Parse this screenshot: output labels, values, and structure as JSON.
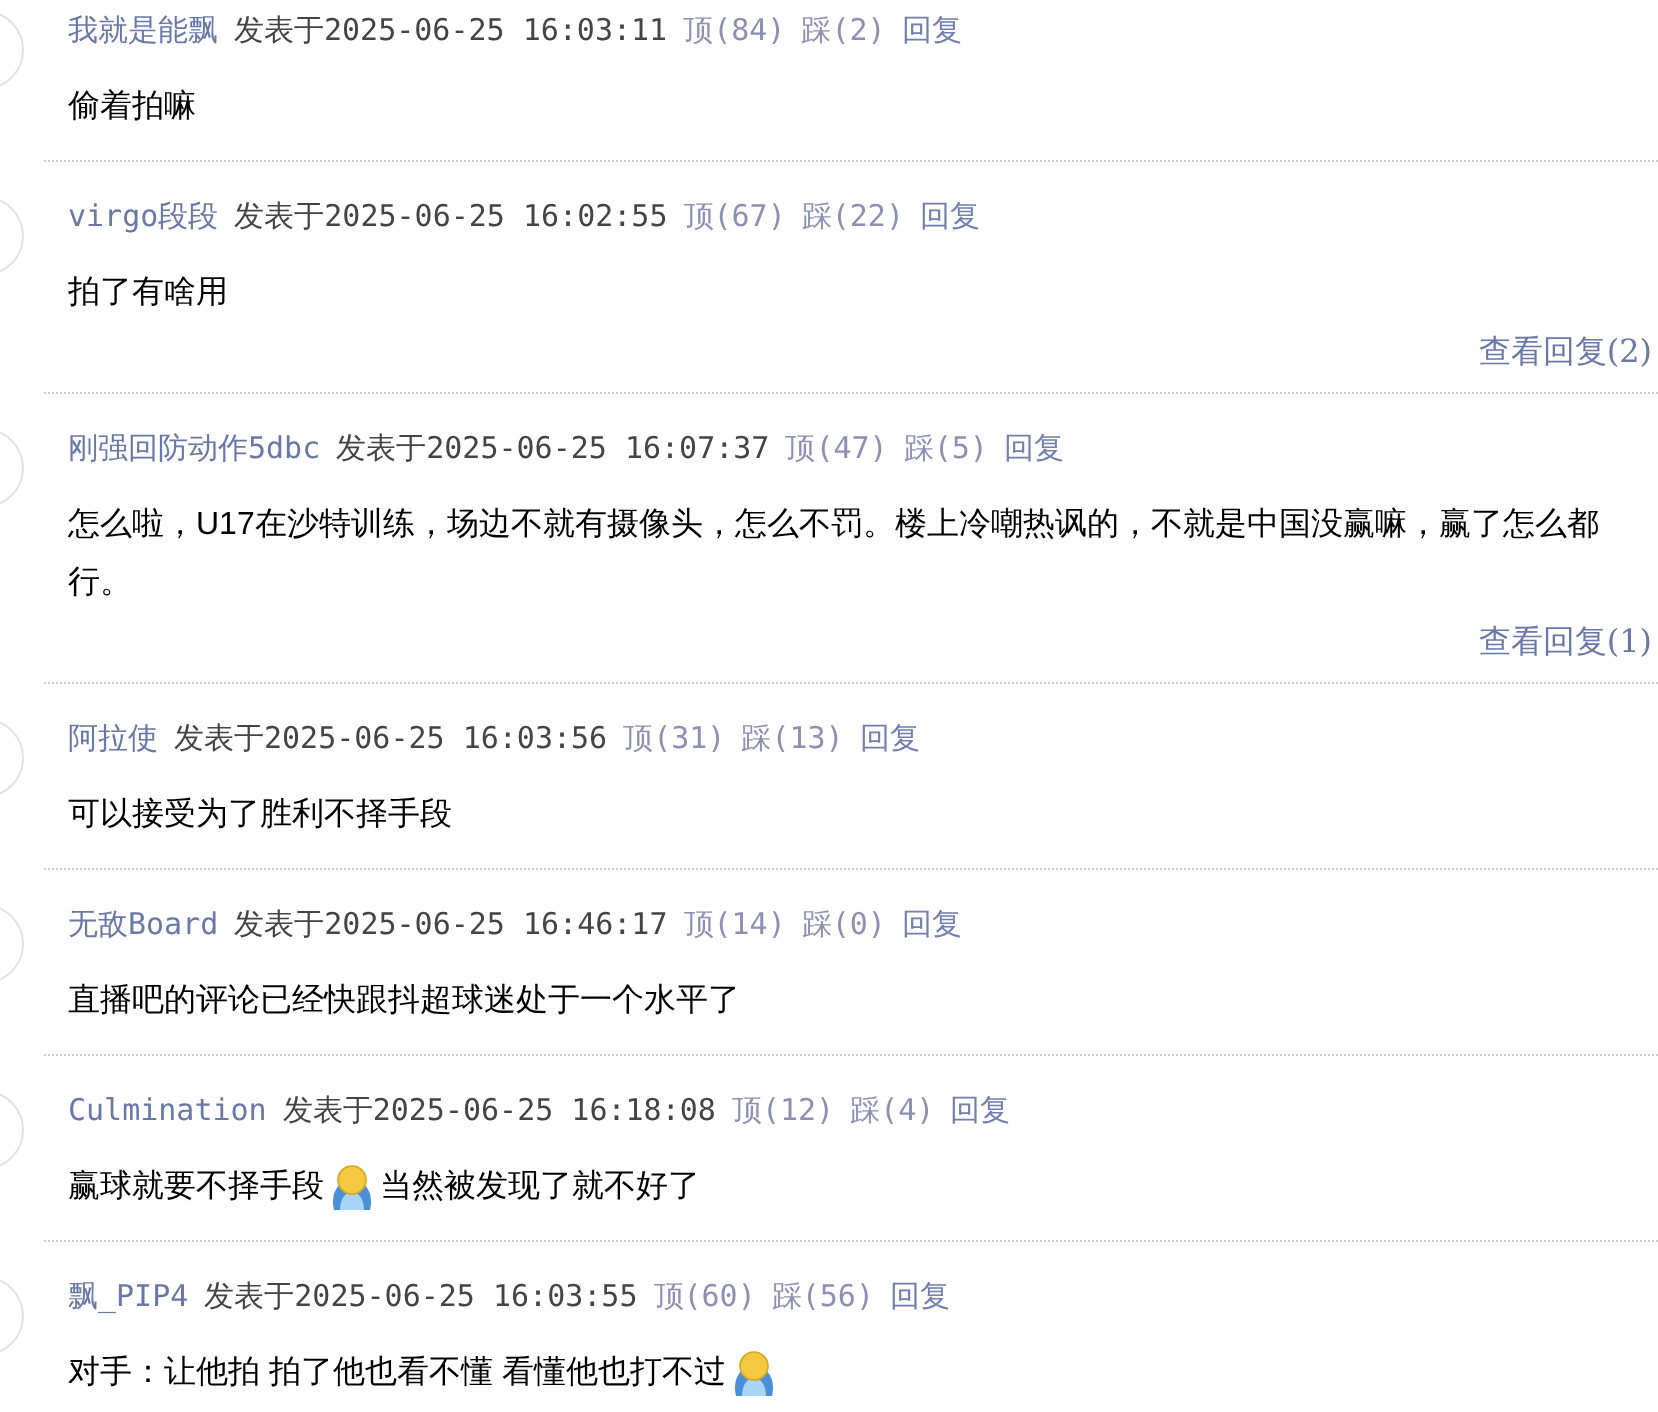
{
  "comments": [
    {
      "author": "我就是能飘",
      "posted": "发表于2025-06-25 16:03:11",
      "up": "顶(84)",
      "down": "踩(2)",
      "reply": "回复",
      "body": [
        {
          "kind": "text",
          "text": "偷着拍嘛"
        }
      ]
    },
    {
      "author": "virgo段段",
      "posted": "发表于2025-06-25 16:02:55",
      "up": "顶(67)",
      "down": "踩(22)",
      "reply": "回复",
      "body": [
        {
          "kind": "text",
          "text": "拍了有啥用"
        }
      ],
      "more_replies": "查看回复(2)"
    },
    {
      "author": "刚强回防动作5dbc",
      "posted": "发表于2025-06-25 16:07:37",
      "up": "顶(47)",
      "down": "踩(5)",
      "reply": "回复",
      "body": [
        {
          "kind": "text",
          "text": "怎么啦，U17在沙特训练，场边不就有摄像头，怎么不罚。楼上冷嘲热讽的，不就是中国没赢嘛，赢了怎么都行。"
        }
      ],
      "more_replies": "查看回复(1)"
    },
    {
      "author": "阿拉使",
      "posted": "发表于2025-06-25 16:03:56",
      "up": "顶(31)",
      "down": "踩(13)",
      "reply": "回复",
      "body": [
        {
          "kind": "text",
          "text": "可以接受为了胜利不择手段"
        }
      ]
    },
    {
      "author": "无敌Board",
      "posted": "发表于2025-06-25 16:46:17",
      "up": "顶(14)",
      "down": "踩(0)",
      "reply": "回复",
      "body": [
        {
          "kind": "text",
          "text": "直播吧的评论已经快跟抖超球迷处于一个水平了"
        }
      ]
    },
    {
      "author": "Culmination",
      "posted": "发表于2025-06-25 16:18:08",
      "up": "顶(12)",
      "down": "踩(4)",
      "reply": "回复",
      "body": [
        {
          "kind": "text",
          "text": "赢球就要不择手段"
        },
        {
          "kind": "emoji"
        },
        {
          "kind": "text",
          "text": "当然被发现了就不好了"
        }
      ]
    },
    {
      "author": "飘_PIP4",
      "posted": "发表于2025-06-25 16:03:55",
      "up": "顶(60)",
      "down": "踩(56)",
      "reply": "回复",
      "body": [
        {
          "kind": "text",
          "text": "对手：让他拍 拍了他也看不懂 看懂他也打不过"
        },
        {
          "kind": "emoji"
        }
      ]
    }
  ]
}
